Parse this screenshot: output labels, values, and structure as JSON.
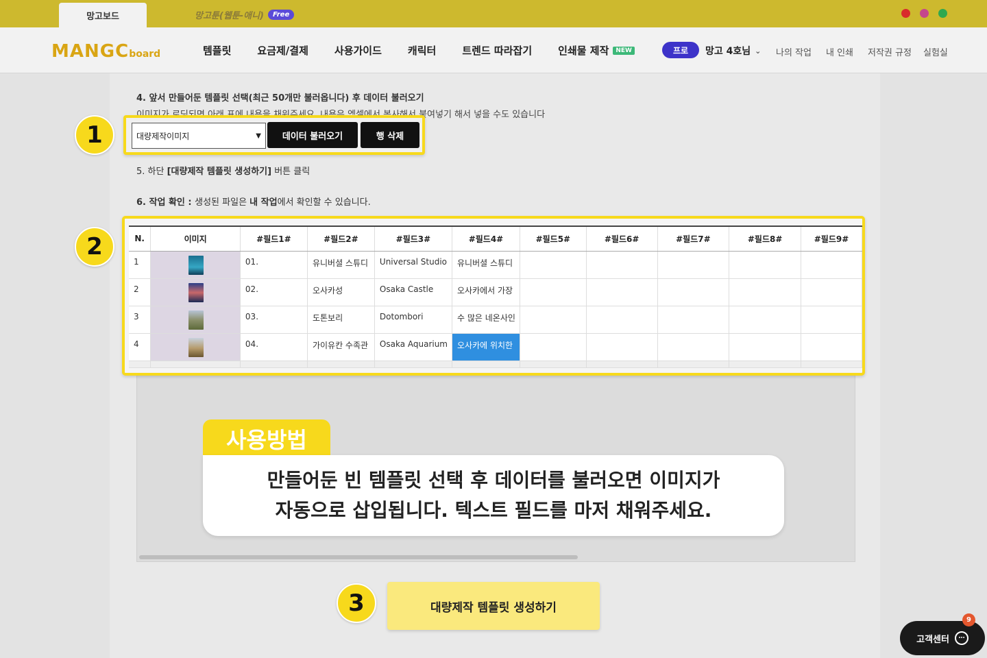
{
  "topbar": {
    "active_tab": "망고보드",
    "other_tab": "망고툰(웹툰-애니)",
    "free_badge": "Free",
    "social_colors": [
      "#d92b2b",
      "#c5468c",
      "#2fa84f"
    ]
  },
  "header": {
    "logo_main": "MANGC",
    "logo_sub": "board",
    "nav": [
      "템플릿",
      "요금제/결제",
      "사용가이드",
      "캐릭터",
      "트렌드 따라잡기",
      "인쇄물 제작"
    ],
    "new_badge": "NEW",
    "pro_label": "프로",
    "user_name": "망고 4호님",
    "utils": [
      "나의 작업",
      "내 인쇄",
      "저작권 규정",
      "실험실"
    ]
  },
  "steps": {
    "step4_title": "4. 앞서 만들어둔 템플릿 선택(최근 50개만 불러옵니다) 후 데이터 불러오기",
    "step4_desc": "이미지가 로딩되면 아래 표에 내용을 채워주세요. 내용은 엑셀에서 복사해서 붙여넣기 해서 넣을 수도 있습니다",
    "step5_prefix": "5. 하단 ",
    "step5_bold": "[대량제작 템플릿 생성하기]",
    "step5_suffix": " 버튼 클릭",
    "step6_bold": "6. 작업 확인 : ",
    "step6_text": "생성된 파일은 ",
    "step6_bold2": "내 작업",
    "step6_suffix": "에서 확인할 수 있습니다."
  },
  "controls": {
    "select_value": "대량제작이미지",
    "load_button": "데이터 불러오기",
    "delete_button": "행 삭제"
  },
  "callouts": [
    "1",
    "2",
    "3"
  ],
  "table": {
    "headers": [
      "N.",
      "이미지",
      "#필드1#",
      "#필드2#",
      "#필드3#",
      "#필드4#",
      "#필드5#",
      "#필드6#",
      "#필드7#",
      "#필드8#",
      "#필드9#"
    ],
    "rows": [
      {
        "n": "1",
        "f1": "01.",
        "f2": "유니버셜 스튜디",
        "f3": "Universal Studio",
        "f4": "유니버셜 스튜디"
      },
      {
        "n": "2",
        "f1": "02.",
        "f2": "오사카성",
        "f3": "Osaka Castle",
        "f4": "오사카에서 가장"
      },
      {
        "n": "3",
        "f1": "03.",
        "f2": "도톤보리",
        "f3": "Dotombori",
        "f4": "수 많은 네온사인"
      },
      {
        "n": "4",
        "f1": "04.",
        "f2": "가이유칸 수족관",
        "f3": "Osaka Aquarium",
        "f4": "오사카에 위치한"
      }
    ],
    "thumb_colors": [
      "#1a6f8f",
      "#2b3f88",
      "#8a8f6a",
      "#b59a6a"
    ]
  },
  "usage": {
    "tag": "사용방법",
    "line1": "만들어둔 빈 템플릿 선택 후 데이터를 불러오면 이미지가",
    "line2": "자동으로 삽입됩니다. 텍스트 필드를 마저 채워주세요."
  },
  "create_button": "대량제작 템플릿 생성하기",
  "cs": {
    "label": "고객센터",
    "badge": "9"
  }
}
